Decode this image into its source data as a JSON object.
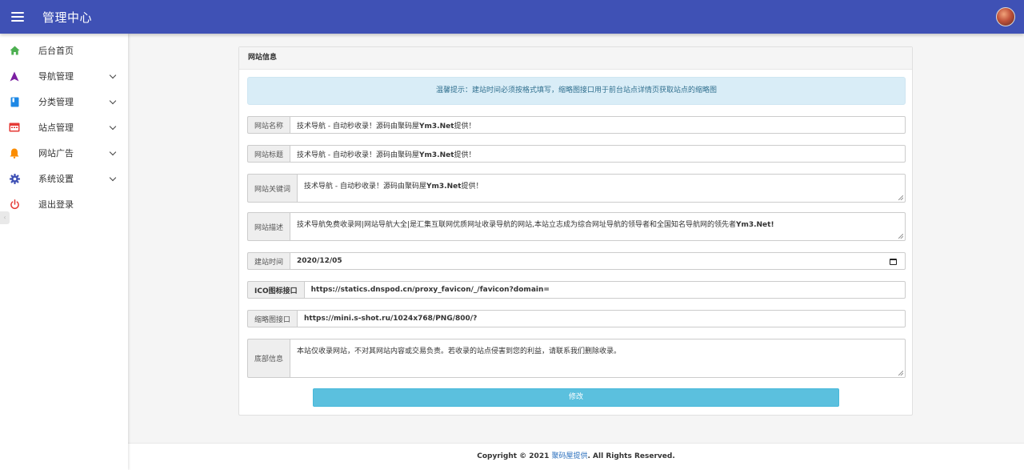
{
  "header": {
    "title": "管理中心",
    "menu_icon": "hamburger-menu-icon",
    "avatar": "user-avatar"
  },
  "sidebar": {
    "items": [
      {
        "label": "后台首页",
        "icon": "home-icon",
        "color": "#4caf50",
        "expandable": false
      },
      {
        "label": "导航管理",
        "icon": "navigation-arrow-icon",
        "color": "#7b1fa2",
        "expandable": true
      },
      {
        "label": "分类管理",
        "icon": "book-icon",
        "color": "#1e88e5",
        "expandable": true
      },
      {
        "label": "站点管理",
        "icon": "calendar-window-icon",
        "color": "#e53935",
        "expandable": true
      },
      {
        "label": "网站广告",
        "icon": "bell-icon",
        "color": "#fb8c00",
        "expandable": true
      },
      {
        "label": "系统设置",
        "icon": "gear-icon",
        "color": "#3f51b5",
        "expandable": true
      },
      {
        "label": "退出登录",
        "icon": "power-icon",
        "color": "#e53935",
        "expandable": false
      }
    ]
  },
  "panel": {
    "title": "网站信息",
    "notice": "温馨提示：建站时间必须按格式填写，缩略图接口用于前台站点详情页获取站点的缩略图",
    "fields": {
      "site_name": {
        "label": "网站名称",
        "prefix": "技术导航 - 自动秒收录！源码由聚码屋",
        "strong": "Ym3.Net",
        "suffix": "提供！"
      },
      "site_title": {
        "label": "网站标题",
        "prefix": "技术导航 - 自动秒收录！源码由聚码屋",
        "strong": "Ym3.Net",
        "suffix": "提供！"
      },
      "keywords": {
        "label": "网站关键词",
        "prefix": "技术导航 - 自动秒收录！源码由聚码屋",
        "strong": "Ym3.Net",
        "suffix": "提供！"
      },
      "description": {
        "label": "网站描述",
        "prefix": "技术导航免费收录网|网站导航大全|是汇集互联网优质网址收录导航的网站,本站立志成为综合网址导航的领导者和全国知名导航网的领先者",
        "strong": "Ym3.Net!",
        "suffix": ""
      },
      "build_date": {
        "label": "建站时间",
        "value": "2020/12/05",
        "icon": "calendar-icon"
      },
      "ico_api": {
        "label": "ICO图标接口",
        "value": "https://statics.dnspod.cn/proxy_favicon/_/favicon?domain="
      },
      "thumb_api": {
        "label": "缩略图接口",
        "value": "https://mini.s-shot.ru/1024x768/PNG/800/?"
      },
      "footer_info": {
        "label": "底部信息",
        "value": "本站仅收录网站，不对其网站内容或交易负责。若收录的站点侵害到您的利益，请联系我们删除收录。"
      }
    },
    "submit_label": "修改"
  },
  "footer": {
    "prefix": "Copyright © 2021 ",
    "link": "聚码屋提供",
    "suffix": ". All Rights Reserved."
  },
  "colors": {
    "primary": "#3f51b5",
    "info_button": "#5bc0de",
    "notice_bg": "#d9edf7",
    "notice_text": "#31708f"
  }
}
